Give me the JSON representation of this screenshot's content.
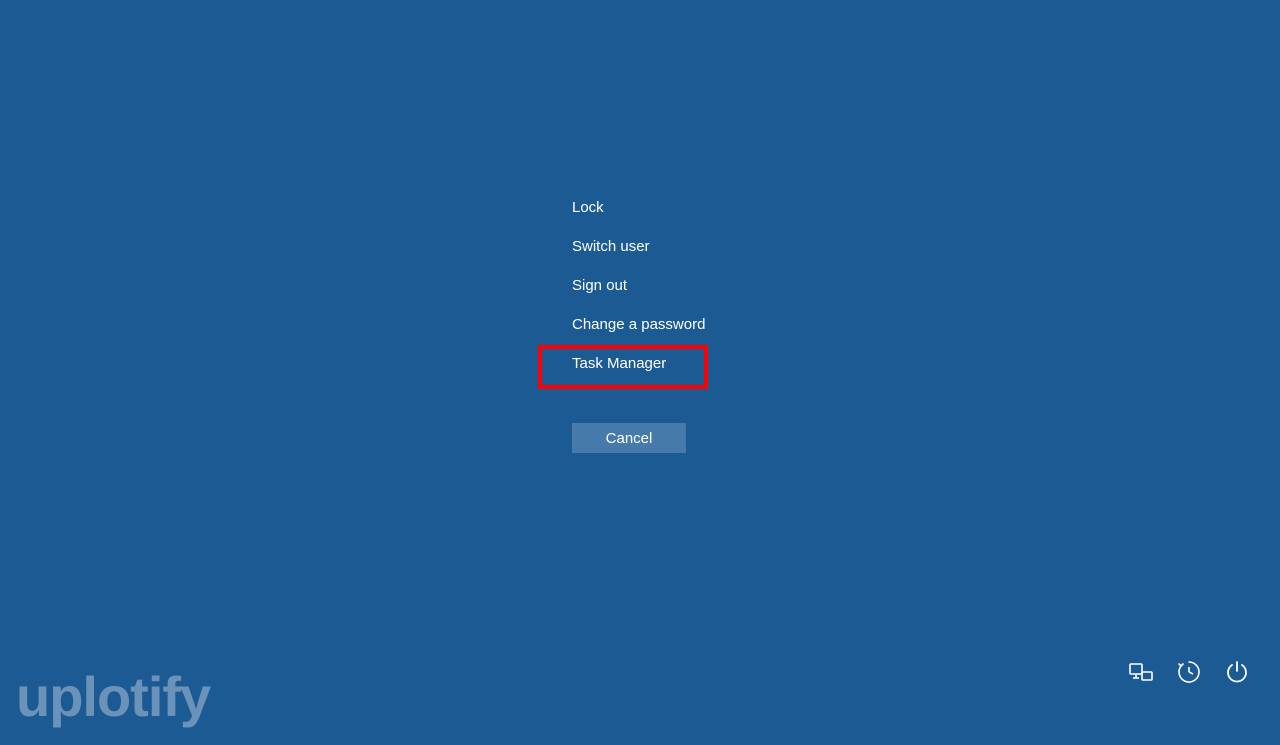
{
  "menu": {
    "items": [
      {
        "label": "Lock"
      },
      {
        "label": "Switch user"
      },
      {
        "label": "Sign out"
      },
      {
        "label": "Change a password"
      },
      {
        "label": "Task Manager"
      }
    ],
    "cancel_label": "Cancel"
  },
  "watermark": "uplotify",
  "highlighted_index": 4
}
